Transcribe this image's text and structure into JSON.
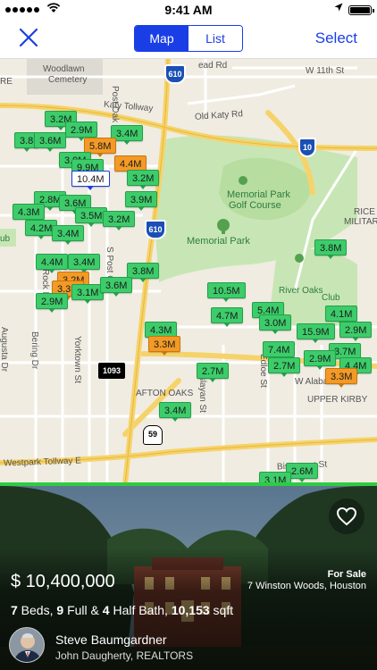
{
  "status_bar": {
    "time": "9:41 AM"
  },
  "nav": {
    "segments": [
      "Map",
      "List"
    ],
    "active_segment": "Map",
    "select_label": "Select"
  },
  "map": {
    "labels": {
      "woodlawn": "Woodlawn",
      "cemetery": "Cemetery",
      "katy_tollway": "Katy Tollway",
      "old_katy": "Old Katy Rd",
      "post_oak": "Post Oak Rd",
      "w11th": "W 11th St",
      "memorial_golf_1": "Memorial Park",
      "memorial_golf_2": "Golf Course",
      "memorial_park": "Memorial Park",
      "rice_military_1": "RICE",
      "rice_military_2": "MILITAR",
      "club": "Club",
      "river_oaks_1": "River Oaks",
      "river_oaks_2": "Country Club",
      "augusta": "Augusta Dr",
      "bering": "Bering Dr",
      "yorktown": "Yorktown St",
      "afton_oaks": "AFTON OAKS",
      "weslayan": "Weslayan St",
      "edloe": "Edloe St",
      "w_alabama": "W Alabama St",
      "upper_kirby": "UPPER KIRBY",
      "westpark": "Westpark Tollway E",
      "bissonnet": "Bissonnet St",
      "s_post_oak": "S Post Oak",
      "rock_rd": "Rock Rd",
      "re": "RE",
      "ead_rd": "ead Rd",
      "ub": "ub"
    },
    "shields": {
      "i610_top": "610",
      "i610_mid": "610",
      "i10": "10",
      "us59": "59",
      "tx1093": "1093"
    },
    "pins": [
      {
        "label": "3.2M",
        "color": "green"
      },
      {
        "label": "2.9M",
        "color": "green"
      },
      {
        "label": "3.4M",
        "color": "green"
      },
      {
        "label": "3.8",
        "color": "green"
      },
      {
        "label": "3.6M",
        "color": "green"
      },
      {
        "label": "5.8M",
        "color": "orange"
      },
      {
        "label": "3.9M",
        "color": "green"
      },
      {
        "label": "4.4M",
        "color": "orange"
      },
      {
        "label": "9.9M",
        "color": "green"
      },
      {
        "label": "10.4M",
        "color": "selected"
      },
      {
        "label": "3.2M",
        "color": "green"
      },
      {
        "label": "2.8M",
        "color": "green"
      },
      {
        "label": "3.6M",
        "color": "green"
      },
      {
        "label": "4.3M",
        "color": "green"
      },
      {
        "label": "3.5M",
        "color": "green"
      },
      {
        "label": "3.2M",
        "color": "green"
      },
      {
        "label": "3.9M",
        "color": "green"
      },
      {
        "label": "4.2M",
        "color": "green"
      },
      {
        "label": "3.4M",
        "color": "green"
      },
      {
        "label": "4.4M",
        "color": "green"
      },
      {
        "label": "3.4M",
        "color": "green"
      },
      {
        "label": "3.8M",
        "color": "green"
      },
      {
        "label": "3.2M",
        "color": "orange"
      },
      {
        "label": "3.3M",
        "color": "orange"
      },
      {
        "label": "3.1M",
        "color": "green"
      },
      {
        "label": "3.6M",
        "color": "green"
      },
      {
        "label": "2.9M",
        "color": "green"
      },
      {
        "label": "3.8M",
        "color": "green"
      },
      {
        "label": "10.5M",
        "color": "green"
      },
      {
        "label": "4.7M",
        "color": "green"
      },
      {
        "label": "5.4M",
        "color": "green"
      },
      {
        "label": "4.1M",
        "color": "green"
      },
      {
        "label": "3.0M",
        "color": "green"
      },
      {
        "label": "15.9M",
        "color": "green"
      },
      {
        "label": "2.9M",
        "color": "green"
      },
      {
        "label": "4.3M",
        "color": "green"
      },
      {
        "label": "3.3M",
        "color": "orange"
      },
      {
        "label": "2.7M",
        "color": "green"
      },
      {
        "label": "7.4M",
        "color": "green"
      },
      {
        "label": "2.7M",
        "color": "green"
      },
      {
        "label": "3.7M",
        "color": "green"
      },
      {
        "label": "2.9M",
        "color": "green"
      },
      {
        "label": "4.4M",
        "color": "green"
      },
      {
        "label": "3.3M",
        "color": "orange"
      },
      {
        "label": "3.4M",
        "color": "green"
      },
      {
        "label": "2.6M",
        "color": "green"
      },
      {
        "label": "3.1M",
        "color": "green"
      }
    ]
  },
  "listing": {
    "price": "$ 10,400,000",
    "status": "For Sale",
    "address": "7 Winston Woods, Houston",
    "beds_num": "7",
    "beds_word": " Beds, ",
    "full_num": "9",
    "full_word": " Full & ",
    "half_num": "4",
    "half_word": " Half Bath, ",
    "sqft_num": "10,153",
    "sqft_word": " sqft",
    "agent_name": "Steve Baumgardner",
    "brokerage": "John Daugherty, REALTORS"
  }
}
